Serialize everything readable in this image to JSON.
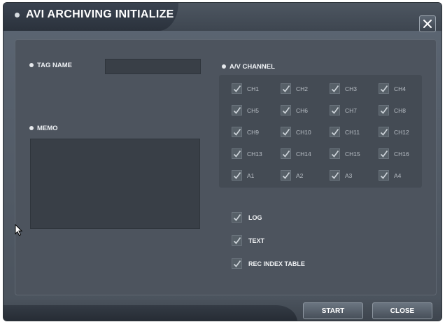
{
  "window": {
    "title": "AVI ARCHIVING INITIALIZE"
  },
  "tag_name": {
    "label": "TAG NAME",
    "value": ""
  },
  "memo": {
    "label": "MEMO",
    "value": ""
  },
  "av_channel": {
    "label": "A/V CHANNEL",
    "channels": [
      {
        "label": "CH1",
        "checked": true
      },
      {
        "label": "CH2",
        "checked": true
      },
      {
        "label": "CH3",
        "checked": true
      },
      {
        "label": "CH4",
        "checked": true
      },
      {
        "label": "CH5",
        "checked": true
      },
      {
        "label": "CH6",
        "checked": true
      },
      {
        "label": "CH7",
        "checked": true
      },
      {
        "label": "CH8",
        "checked": true
      },
      {
        "label": "CH9",
        "checked": true
      },
      {
        "label": "CH10",
        "checked": true
      },
      {
        "label": "CH11",
        "checked": true
      },
      {
        "label": "CH12",
        "checked": true
      },
      {
        "label": "CH13",
        "checked": true
      },
      {
        "label": "CH14",
        "checked": true
      },
      {
        "label": "CH15",
        "checked": true
      },
      {
        "label": "CH16",
        "checked": true
      },
      {
        "label": "A1",
        "checked": true
      },
      {
        "label": "A2",
        "checked": true
      },
      {
        "label": "A3",
        "checked": true
      },
      {
        "label": "A4",
        "checked": true
      }
    ]
  },
  "options": [
    {
      "label": "LOG",
      "checked": true
    },
    {
      "label": "TEXT",
      "checked": true
    },
    {
      "label": "REC INDEX TABLE",
      "checked": true
    }
  ],
  "buttons": {
    "start": "START",
    "close": "CLOSE"
  },
  "colors": {
    "check": "#cfd5db",
    "window": "#4d545e"
  }
}
